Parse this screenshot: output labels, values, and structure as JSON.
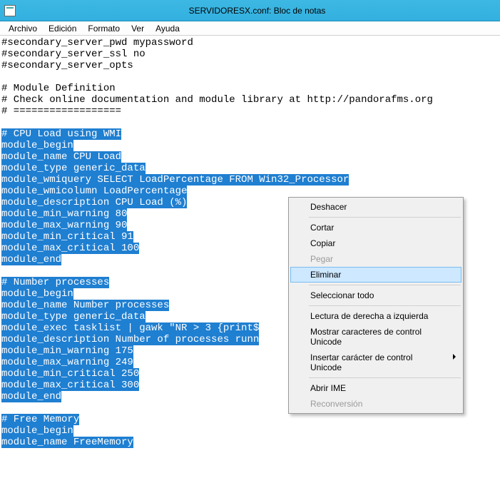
{
  "window": {
    "title": "SERVIDORESX.conf: Bloc de notas"
  },
  "menubar": {
    "items": [
      "Archivo",
      "Edición",
      "Formato",
      "Ver",
      "Ayuda"
    ]
  },
  "editor": {
    "plain_lines": [
      "#secondary_server_pwd mypassword",
      "#secondary_server_ssl no",
      "#secondary_server_opts",
      "",
      "# Module Definition",
      "# Check online documentation and module library at http://pandorafms.org",
      "# =================="
    ],
    "selected_block1": [
      "# CPU Load using WMI",
      "module_begin",
      "module_name CPU Load",
      "module_type generic_data",
      "module_wmiquery SELECT LoadPercentage FROM Win32_Processor",
      "module_wmicolumn LoadPercentage",
      "module_description CPU Load (%)",
      "module_min_warning 80",
      "module_max_warning 90",
      "module_min_critical 91",
      "module_max_critical 100",
      "module_end"
    ],
    "selected_block2": [
      "# Number processes",
      "module_begin",
      "module_name Number processes",
      "module_type generic_data",
      "module_exec tasklist | gawk \"NR > 3 {print$",
      "module_description Number of processes runn",
      "module_min_warning 175",
      "module_max_warning 249",
      "module_min_critical 250",
      "module_max_critical 300",
      "module_end"
    ],
    "selected_block3": [
      "# Free Memory",
      "module_begin",
      "module_name FreeMemory"
    ]
  },
  "context_menu": {
    "items": [
      {
        "label": "Deshacer",
        "enabled": true
      },
      {
        "sep": true
      },
      {
        "label": "Cortar",
        "enabled": true
      },
      {
        "label": "Copiar",
        "enabled": true
      },
      {
        "label": "Pegar",
        "enabled": false
      },
      {
        "label": "Eliminar",
        "enabled": true,
        "highlight": true
      },
      {
        "sep": true
      },
      {
        "label": "Seleccionar todo",
        "enabled": true
      },
      {
        "sep": true
      },
      {
        "label": "Lectura de derecha a izquierda",
        "enabled": true
      },
      {
        "label": "Mostrar caracteres de control Unicode",
        "enabled": true
      },
      {
        "label": "Insertar carácter de control Unicode",
        "enabled": true,
        "submenu": true
      },
      {
        "sep": true
      },
      {
        "label": "Abrir IME",
        "enabled": true
      },
      {
        "label": "Reconversión",
        "enabled": false
      }
    ]
  }
}
